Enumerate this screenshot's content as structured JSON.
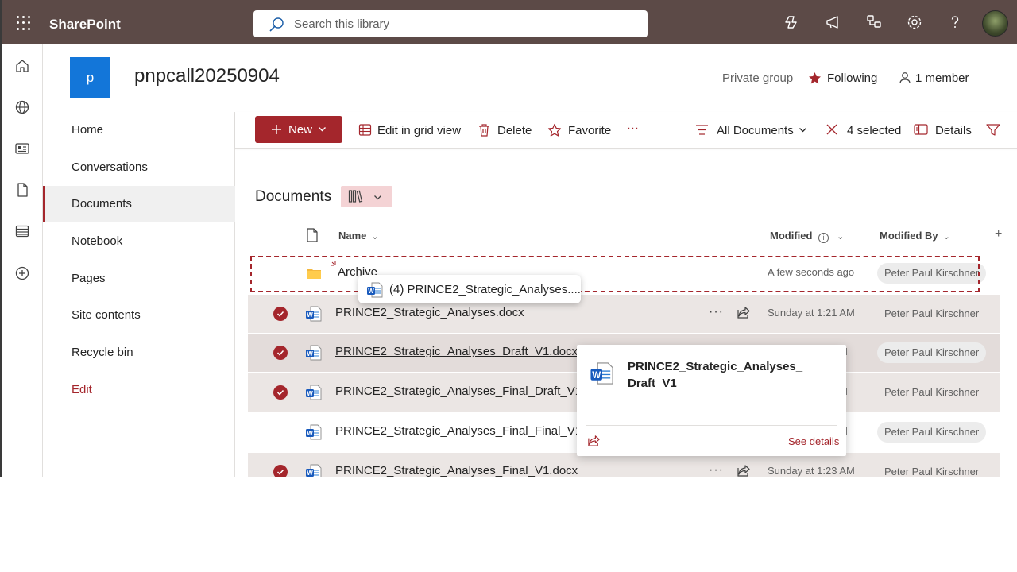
{
  "suite": {
    "app_name": "SharePoint",
    "search_placeholder": "Search this library"
  },
  "site": {
    "logo_letter": "p",
    "title": "pnpcall20250904",
    "privacy": "Private group",
    "following_label": "Following",
    "members_label": "1 member"
  },
  "nav": {
    "items": [
      {
        "label": "Home"
      },
      {
        "label": "Conversations"
      },
      {
        "label": "Documents"
      },
      {
        "label": "Notebook"
      },
      {
        "label": "Pages"
      },
      {
        "label": "Site contents"
      },
      {
        "label": "Recycle bin"
      },
      {
        "label": "Edit"
      }
    ],
    "active": "Documents"
  },
  "commands": {
    "new_label": "New",
    "grid_label": "Edit in grid view",
    "delete_label": "Delete",
    "favorite_label": "Favorite",
    "more_label": "···",
    "view_label": "All Documents",
    "selected_label": "4 selected",
    "details_label": "Details"
  },
  "library": {
    "title": "Documents",
    "columns": {
      "name": "Name",
      "modified": "Modified",
      "modified_by": "Modified By",
      "add": "+"
    },
    "rows": [
      {
        "name": "Archive",
        "type": "folder",
        "modified": "A few seconds ago",
        "modified_by": "Peter Paul Kirschner",
        "selected": false
      },
      {
        "name": "PRINCE2_Strategic_Analyses.docx",
        "type": "word",
        "modified": "Sunday at 1:21 AM",
        "modified_by": "Peter Paul Kirschner",
        "selected": true
      },
      {
        "name": "PRINCE2_Strategic_Analyses_Draft_V1.docx",
        "type": "word",
        "modified": "M",
        "modified_by": "Peter Paul Kirschner",
        "selected": true
      },
      {
        "name": "PRINCE2_Strategic_Analyses_Final_Draft_V1.do",
        "type": "word",
        "modified": "M",
        "modified_by": "Peter Paul Kirschner",
        "selected": true
      },
      {
        "name": "PRINCE2_Strategic_Analyses_Final_Final_V1.do",
        "type": "word",
        "modified": "M",
        "modified_by": "Peter Paul Kirschner",
        "selected": false
      },
      {
        "name": "PRINCE2_Strategic_Analyses_Final_V1.docx",
        "type": "word",
        "modified": "Sunday at 1:23 AM",
        "modified_by": "Peter Paul Kirschner",
        "selected": true
      }
    ]
  },
  "drag": {
    "label": "(4) PRINCE2_Strategic_Analyses...."
  },
  "hovercard": {
    "name": "PRINCE2_Strategic_Analyses_Draft_V1",
    "see_details": "See details"
  },
  "colors": {
    "suite_bar": "#5c4a47",
    "accent": "#a4262c",
    "site_logo": "#1376d9",
    "selected_row": "#ebe6e4"
  }
}
